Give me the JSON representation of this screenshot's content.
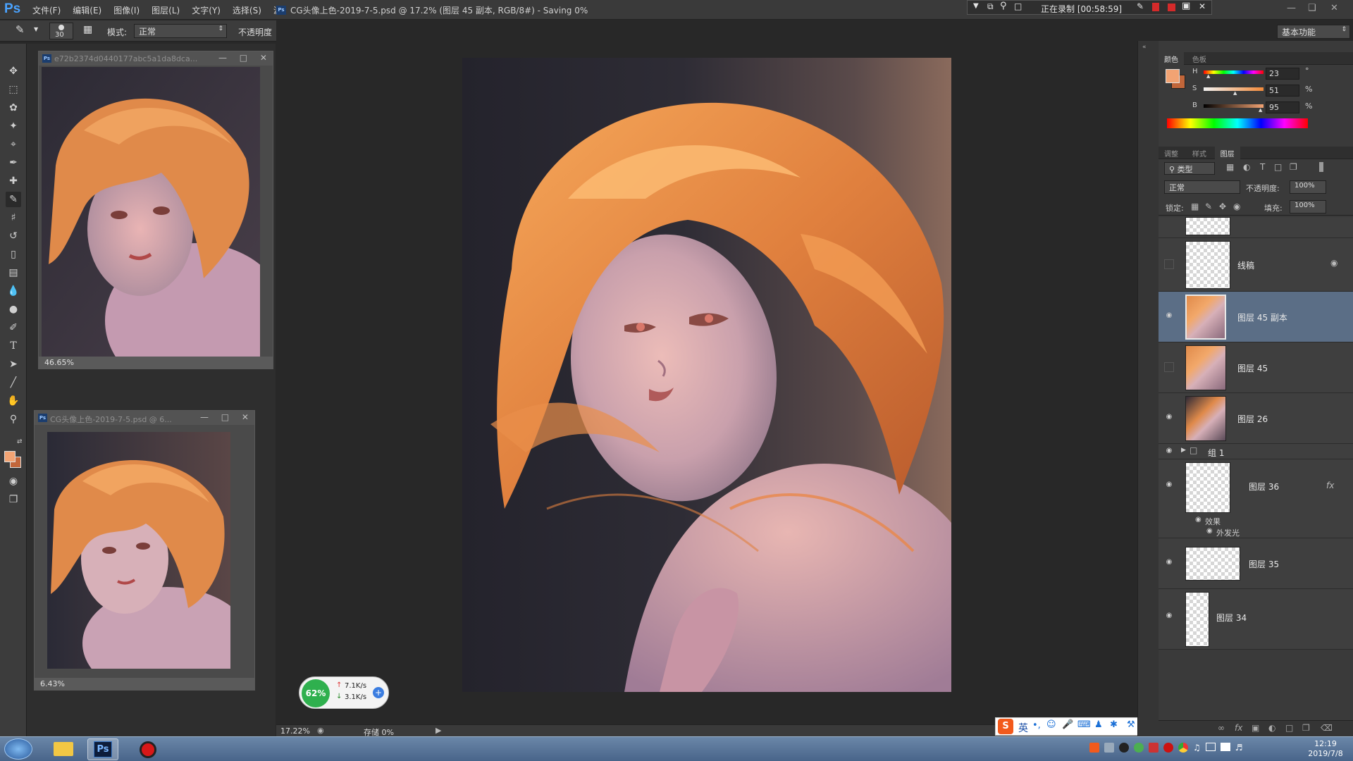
{
  "app": {
    "logo": "Ps",
    "menus": [
      "文件(F)",
      "编辑(E)",
      "图像(I)",
      "图层(L)",
      "文字(Y)",
      "选择(S)",
      "滤"
    ]
  },
  "options": {
    "brush_size": "30",
    "mode_label": "模式:",
    "mode_value": "正常",
    "opacity_label": "不透明度"
  },
  "document": {
    "tab_title": "CG头像上色-2019-7-5.psd @ 17.2% (图层 45 副本, RGB/8#) - Saving 0%"
  },
  "recording": {
    "label": "正在录制 [00:58:59]"
  },
  "workspace": {
    "value": "基本功能"
  },
  "float_window_1": {
    "title": "e72b2374d0440177abc5a1da8dca...",
    "zoom": "46.65%"
  },
  "float_window_2": {
    "title": "CG头像上色-2019-7-5.psd @ 6...",
    "zoom": "6.43%"
  },
  "status": {
    "zoom": "17.22%",
    "saving": "存储 0%"
  },
  "net": {
    "percent": "62%",
    "up": "7.1K/s",
    "down": "3.1K/s"
  },
  "color_panel": {
    "tabs": [
      "颜色",
      "色板"
    ],
    "h_label": "H",
    "h_value": "23",
    "h_unit": "°",
    "s_label": "S",
    "s_value": "51",
    "s_unit": "%",
    "b_label": "B",
    "b_value": "95",
    "b_unit": "%",
    "foreground": "#f2a373",
    "background": "#c2663a"
  },
  "layers_panel": {
    "tabs": [
      "调整",
      "样式",
      "图层"
    ],
    "filter_label": "类型",
    "blend_mode": "正常",
    "opacity_label": "不透明度:",
    "opacity_value": "100%",
    "lock_label": "锁定:",
    "fill_label": "填充:",
    "fill_value": "100%",
    "layers": [
      {
        "name": "线稿"
      },
      {
        "name": "图层 45 副本"
      },
      {
        "name": "图层 45"
      },
      {
        "name": "图层 26"
      },
      {
        "name": "组 1"
      },
      {
        "name": "图层 36",
        "fx": "fx",
        "effects_label": "效果",
        "effect": "外发光"
      },
      {
        "name": "图层 35"
      },
      {
        "name": "图层 34"
      }
    ]
  },
  "ime": {
    "logo": "S",
    "lang": "英"
  },
  "taskbar": {
    "time": "12:19",
    "date": "2019/7/8",
    "ps_label": "Ps"
  }
}
